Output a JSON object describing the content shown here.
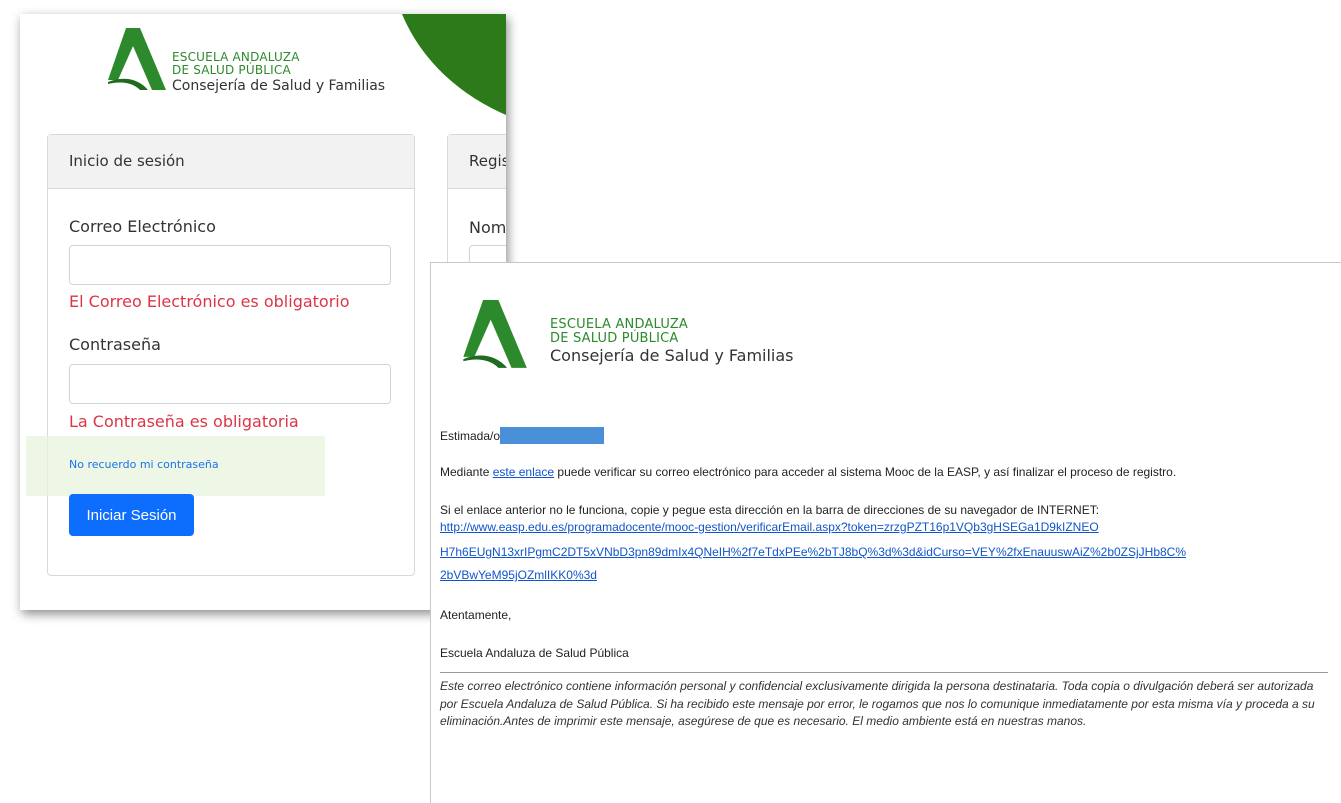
{
  "logo": {
    "line1": "ESCUELA ANDALUZA",
    "line2": "DE SALUD PÚBLICA",
    "line3": "Consejería de Salud y Familias",
    "color": "#2c8a2c"
  },
  "login": {
    "header": "Inicio de sesión",
    "email_label": "Correo Electrónico",
    "email_value": "",
    "email_error": "El Correo Electrónico es obligatorio",
    "password_label": "Contraseña",
    "password_value": "",
    "password_error": "La Contraseña es obligatoria",
    "forgot_link": "No recuerdo mi contraseña",
    "submit": "Iniciar Sesión"
  },
  "register": {
    "header": "Regis",
    "name_label": "Nom"
  },
  "email": {
    "greeting": "Estimada/o",
    "body1_prefix": "Mediante ",
    "body1_link": "este enlace",
    "body1_suffix": " puede verificar su correo electrónico para acceder al sistema Mooc de la EASP, y así finalizar el proceso de registro.",
    "body2": "Si el enlace anterior no le funciona, copie y pegue esta dirección en la barra de direcciones de su navegador de INTERNET:",
    "url_line1": "http://www.easp.edu.es/programadocente/mooc-gestion/verificarEmail.aspx?token=zrzgPZT16p1VQb3gHSEGa1D9kIZNEO",
    "url_line2": "H7h6EUgN13xrIPgmC2DT5xVNbD3pn89dmIx4QNeIH%2f7eTdxPEe%2bTJ8bQ%3d%3d&idCurso=VEY%2fxEnauuswAiZ%2b0ZSjJHb8C%",
    "url_line3": "2bVBwYeM95jOZmlIKK0%3d",
    "closing": "Atentamente,",
    "signature": "Escuela Andaluza de Salud Pública",
    "disclaimer": "Este correo electrónico contiene información personal y confidencial exclusivamente dirigida la persona destinataria. Toda copia o divulgación deberá ser autorizada por Escuela Andaluza de Salud Pública. Si ha recibido este mensaje por error, le rogamos que nos lo comunique inmediatamente por esta misma vía y proceda a su eliminación.Antes de imprimir este mensaje, asegúrese de que es necesario. El medio ambiente está en nuestras manos."
  },
  "colors": {
    "brand_green": "#2c7a19",
    "error_red": "#dc3545",
    "primary_blue": "#0d6efd",
    "link_blue": "#1155cc"
  }
}
